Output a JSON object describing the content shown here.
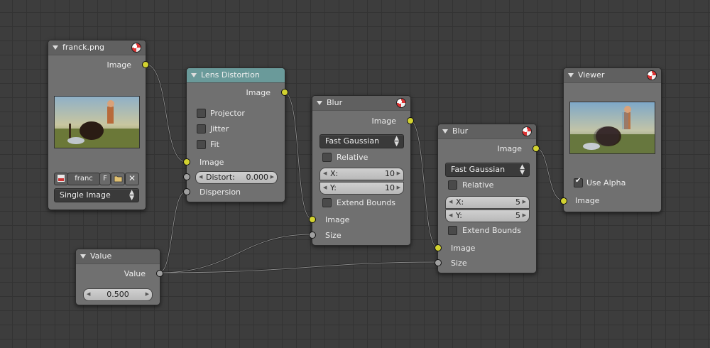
{
  "nodes": {
    "image": {
      "title": "franck.png",
      "output_image": "Image",
      "filename": "franc",
      "fake_user": "F",
      "source": "Single Image"
    },
    "lens": {
      "title": "Lens Distortion",
      "output_image": "Image",
      "projector": "Projector",
      "jitter": "Jitter",
      "fit": "Fit",
      "input_image": "Image",
      "distort_label": "Distort:",
      "distort_value": "0.000",
      "dispersion": "Dispersion"
    },
    "blur1": {
      "title": "Blur",
      "output_image": "Image",
      "filter": "Fast Gaussian",
      "relative": "Relative",
      "x_label": "X:",
      "x_value": "10",
      "y_label": "Y:",
      "y_value": "10",
      "extend_bounds": "Extend Bounds",
      "input_image": "Image",
      "size": "Size"
    },
    "blur2": {
      "title": "Blur",
      "output_image": "Image",
      "filter": "Fast Gaussian",
      "relative": "Relative",
      "x_label": "X:",
      "x_value": "5",
      "y_label": "Y:",
      "y_value": "5",
      "extend_bounds": "Extend Bounds",
      "input_image": "Image",
      "size": "Size"
    },
    "viewer": {
      "title": "Viewer",
      "use_alpha": "Use Alpha",
      "use_alpha_checked": true,
      "input_image": "Image"
    },
    "value": {
      "title": "Value",
      "output": "Value",
      "value": "0.500"
    }
  },
  "colors": {
    "image_socket": "#d2d230",
    "value_socket": "#a0a0a0",
    "lens_header": "#6a9a9a",
    "node_body": "#707070",
    "grid_background": "#3d3d3d"
  }
}
